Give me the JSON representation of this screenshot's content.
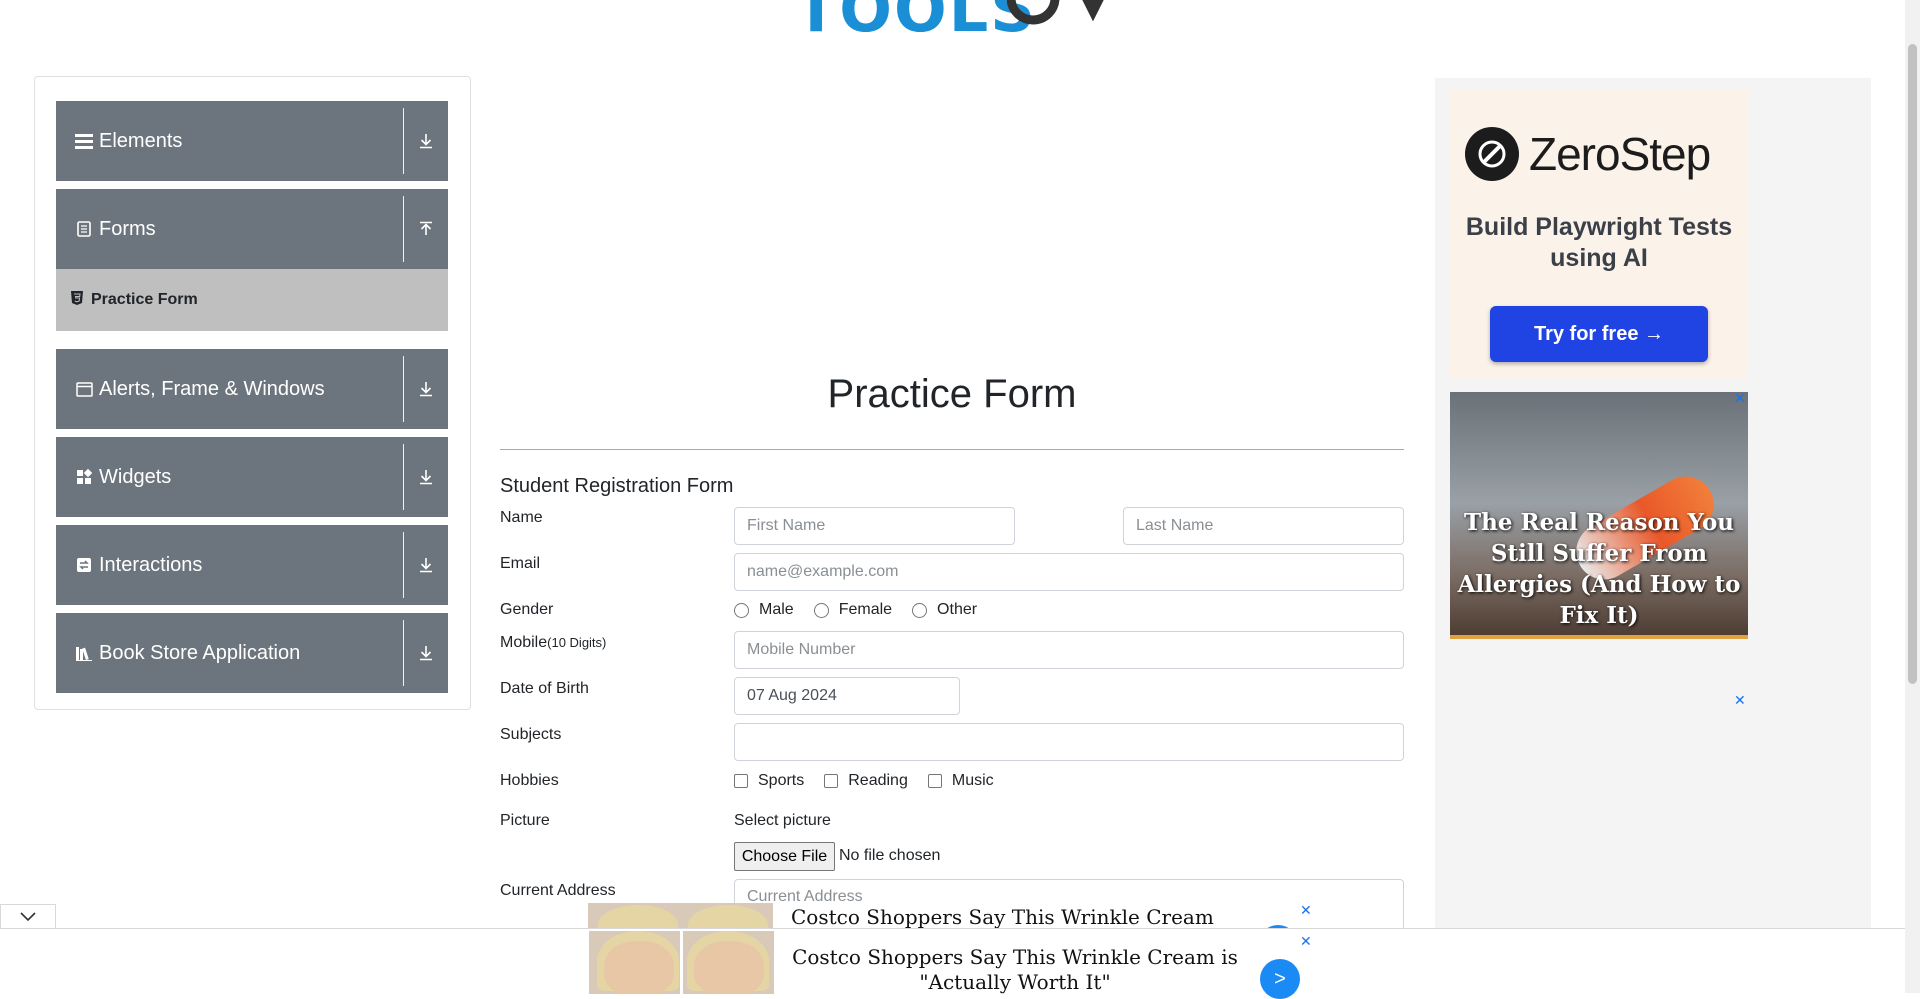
{
  "header": {
    "logo_text_main": "TOOLS",
    "logo_text_qa": "QA"
  },
  "sidebar": {
    "groups": [
      {
        "label": "Elements",
        "icon": "hamburger-icon"
      },
      {
        "label": "Forms",
        "icon": "document-icon"
      },
      {
        "label": "Alerts, Frame & Windows",
        "icon": "window-icon"
      },
      {
        "label": "Widgets",
        "icon": "widgets-icon"
      },
      {
        "label": "Interactions",
        "icon": "interactions-icon"
      },
      {
        "label": "Book Store Application",
        "icon": "books-icon"
      }
    ],
    "active_item": {
      "label": "Practice Form",
      "icon": "html5-icon"
    }
  },
  "form": {
    "page_title": "Practice Form",
    "subtitle": "Student Registration Form",
    "name_label": "Name",
    "first_name_placeholder": "First Name",
    "last_name_placeholder": "Last Name",
    "email_label": "Email",
    "email_placeholder": "name@example.com",
    "gender_label": "Gender",
    "gender_options": [
      "Male",
      "Female",
      "Other"
    ],
    "mobile_label": "Mobile",
    "mobile_hint": "(10 Digits)",
    "mobile_placeholder": "Mobile Number",
    "dob_label": "Date of Birth",
    "dob_value": "07 Aug 2024",
    "subjects_label": "Subjects",
    "hobbies_label": "Hobbies",
    "hobby_options": [
      "Sports",
      "Reading",
      "Music"
    ],
    "picture_label": "Picture",
    "select_picture_label": "Select picture",
    "choose_file_label": "Choose File",
    "no_file_text": "No file chosen",
    "address_label": "Current Address",
    "address_placeholder": "Current Address"
  },
  "ads": {
    "zerostep": {
      "brand": "ZeroStep",
      "tagline": "Build Playwright Tests using AI",
      "cta": "Try for free →"
    },
    "allergy": {
      "headline": "The Real Reason You Still Suffer From Allergies (And How to Fix It)"
    },
    "bottom_overlay_headline": "Costco Shoppers Say This Wrinkle Cream is Absolutely",
    "bottom_headline": "Costco Shoppers Say This Wrinkle Cream is \"Actually Worth It\"",
    "close_glyph": "✕",
    "next_glyph": ">"
  }
}
